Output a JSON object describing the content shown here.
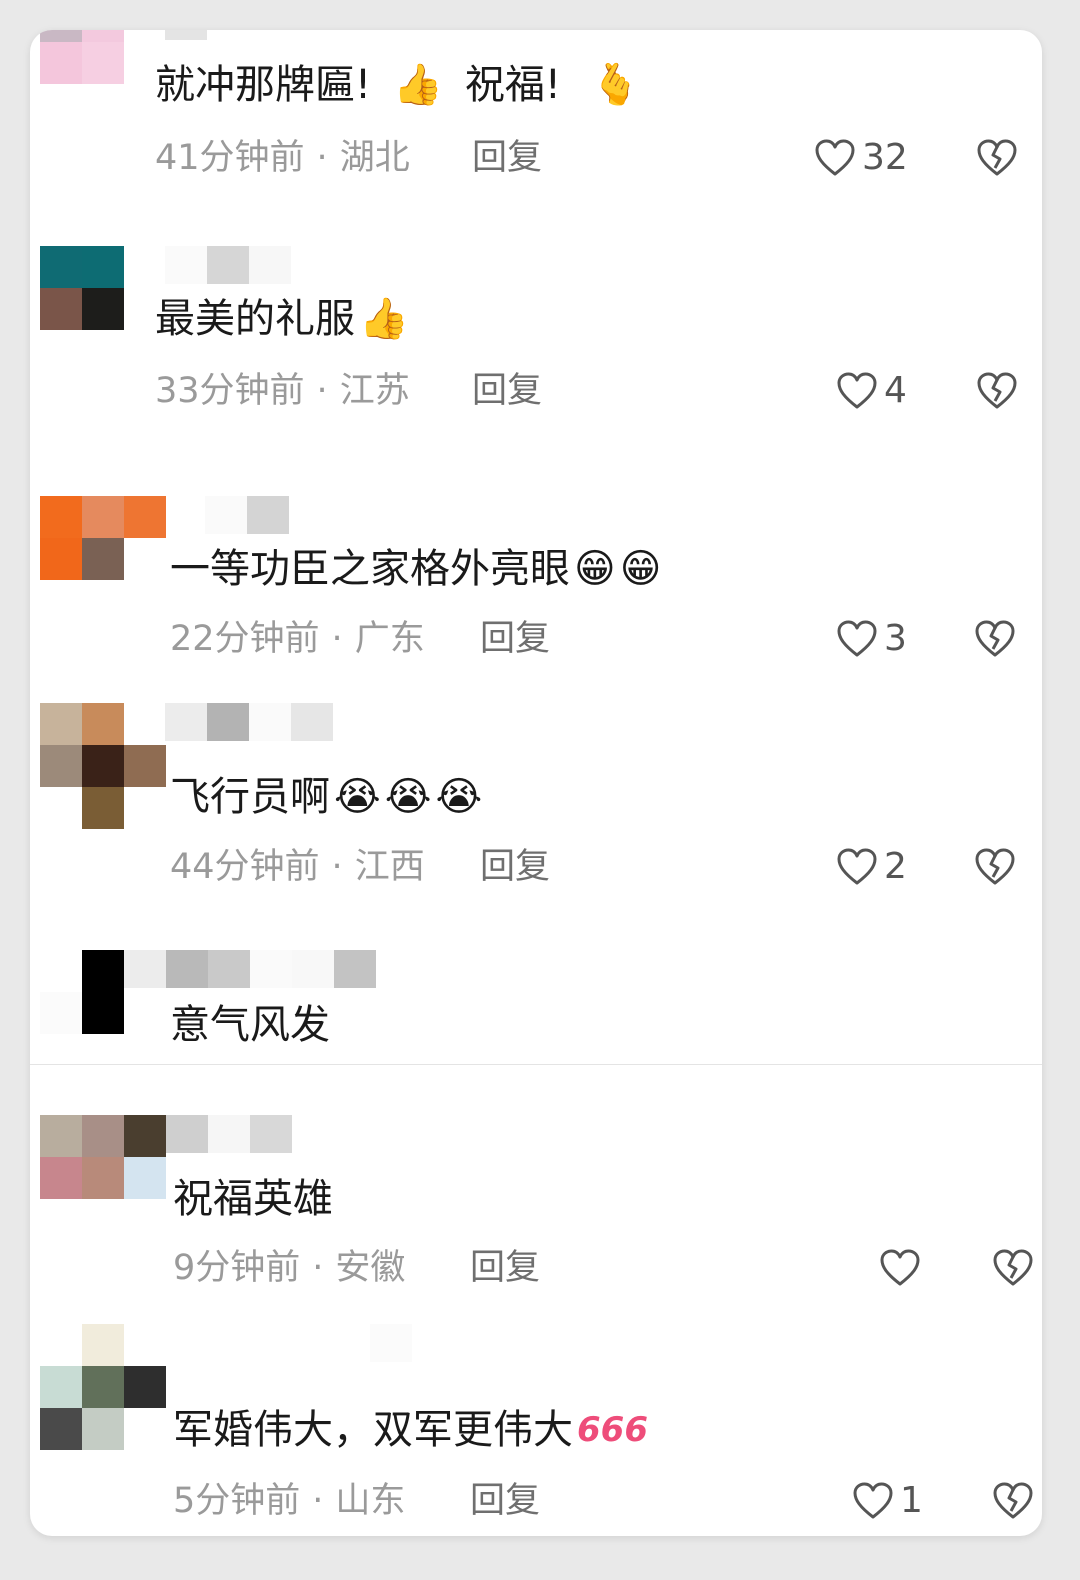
{
  "comments": [
    {
      "text": "就冲那牌匾!",
      "emoji_1": "👍",
      "text_2": "祝福!",
      "emoji_2": "🫰",
      "time": "41分钟前",
      "region": "湖北",
      "reply": "回复",
      "likes": "32"
    },
    {
      "text": "最美的礼服",
      "emoji_1": "👍",
      "time": "33分钟前",
      "region": "江苏",
      "reply": "回复",
      "likes": "4"
    },
    {
      "text": "一等功臣之家格外亮眼",
      "emoji_1": "😁",
      "emoji_2": "😁",
      "time": "22分钟前",
      "region": "广东",
      "reply": "回复",
      "likes": "3"
    },
    {
      "text": "飞行员啊",
      "emoji_1": "😭",
      "emoji_2": "😭",
      "emoji_3": "😭",
      "time": "44分钟前",
      "region": "江西",
      "reply": "回复",
      "likes": "2"
    },
    {
      "text": "意气风发"
    },
    {
      "text": "祝福英雄",
      "time": "9分钟前",
      "region": "安徽",
      "reply": "回复",
      "likes": ""
    },
    {
      "text": "军婚伟大，双军更伟大",
      "emoji_1": "666",
      "time": "5分钟前",
      "region": "山东",
      "reply": "回复",
      "likes": "1"
    }
  ],
  "colors": {
    "meta_gray": "#9a9a9a",
    "reply_gray": "#6f6f6f",
    "icon_gray": "#555555",
    "card_bg": "#ffffff",
    "page_bg": "#e9e9e9"
  },
  "icons": {
    "like": "heart-outline-icon",
    "dislike": "broken-heart-icon"
  }
}
